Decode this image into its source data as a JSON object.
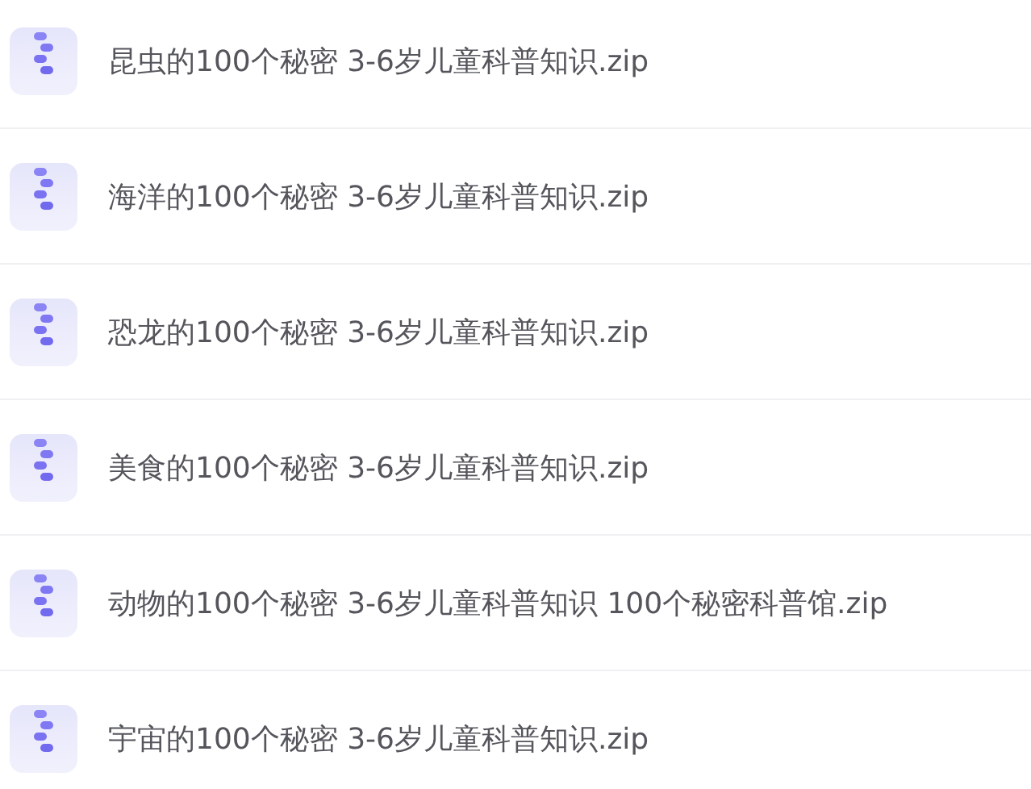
{
  "files": [
    {
      "name": "昆虫的100个秘密 3-6岁儿童科普知识.zip"
    },
    {
      "name": "海洋的100个秘密 3-6岁儿童科普知识.zip"
    },
    {
      "name": "恐龙的100个秘密 3-6岁儿童科普知识.zip"
    },
    {
      "name": "美食的100个秘密 3-6岁儿童科普知识.zip"
    },
    {
      "name": "动物的100个秘密 3-6岁儿童科普知识 100个秘密科普馆.zip"
    },
    {
      "name": "宇宙的100个秘密 3-6岁儿童科普知识.zip"
    }
  ]
}
